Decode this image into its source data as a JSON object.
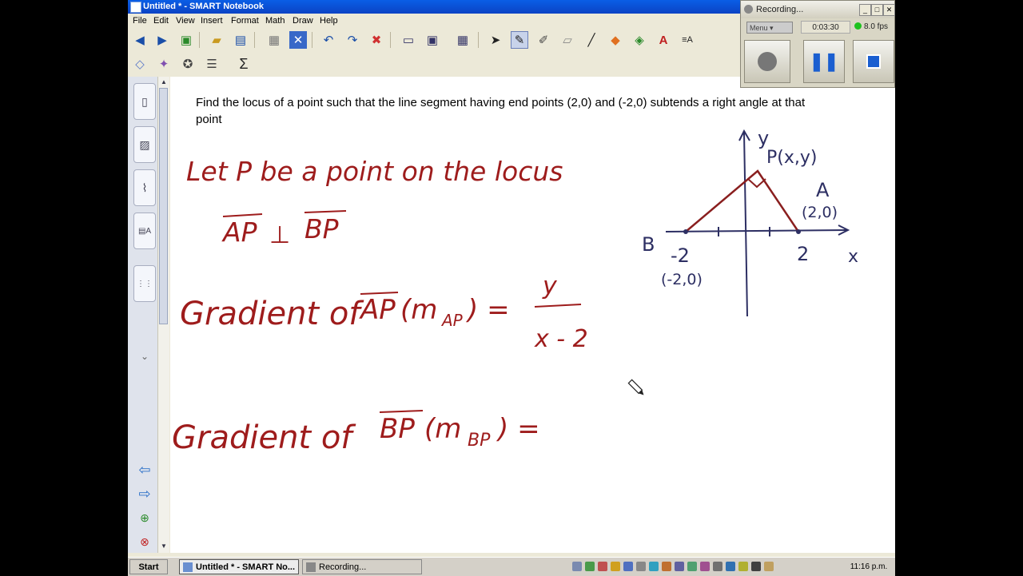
{
  "window": {
    "title": "Untitled * - SMART Notebook"
  },
  "menu": [
    "File",
    "Edit",
    "View",
    "Insert",
    "Format",
    "Math",
    "Draw",
    "Help"
  ],
  "toolbar1": [
    "back-icon",
    "forward-icon",
    "add-page-icon",
    "open-folder-icon",
    "save-icon",
    "paste-icon",
    "delete-page-icon",
    "undo-icon",
    "redo-icon",
    "delete-icon",
    "screen-shade-icon",
    "full-screen-icon",
    "table-icon",
    "select-icon",
    "pen-icon",
    "creative-pen-icon",
    "eraser-icon",
    "line-icon",
    "shapes-icon",
    "fill-icon",
    "text-icon",
    "properties-icon"
  ],
  "toolbar2": [
    "dual-display-icon",
    "magic-pen-icon",
    "shape-recognition-icon",
    "text-format-icon"
  ],
  "toolbar2_sigma": "Σ",
  "question": {
    "text": "Find the locus of a point such that the line segment having end points (2,0) and (-2,0) subtends a right angle at that point"
  },
  "handwriting": {
    "line1": "Let P be a point on the locus",
    "line2_left": "AP",
    "line2_symbol": "⊥",
    "line2_right": "BP",
    "line3_prefix": "Gradient of",
    "line3_seg": "AP",
    "line3_m": "(m",
    "line3_sub": "AP",
    "line3_close": ") =",
    "line3_num": "y",
    "line3_den": "x - 2",
    "line4_prefix": "Gradient of",
    "line4_seg": "BP",
    "line4_m": "(m",
    "line4_sub": "BP",
    "line4_close": ") ="
  },
  "graph": {
    "y_label": "y",
    "x_label": "x",
    "p_label": "P(x,y)",
    "a_label": "A",
    "a_coords": "(2,0)",
    "b_label": "B",
    "b_coords": "(-2,0)",
    "tick_neg": "-2",
    "tick_pos": "2"
  },
  "recorder": {
    "title": "Recording...",
    "menu_label": "Menu",
    "time": "0:03:30",
    "fps": "8.0 fps"
  },
  "taskbar": {
    "start": "Start",
    "tasks": [
      "Untitled * - SMART No...",
      "Recording..."
    ],
    "clock": "11:16 p.m."
  }
}
